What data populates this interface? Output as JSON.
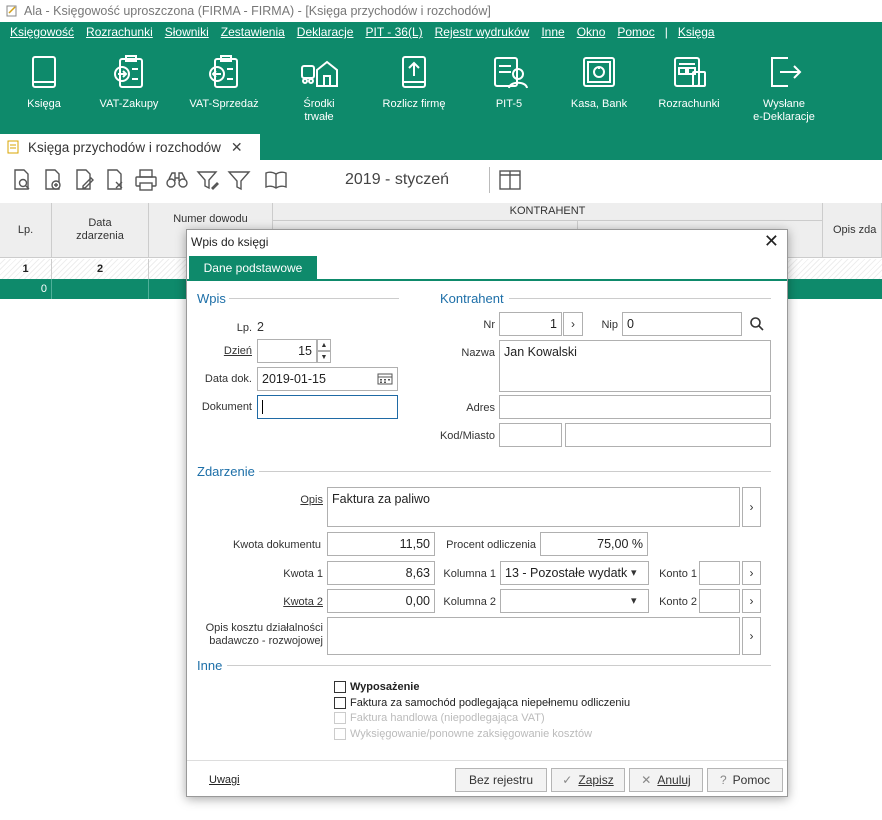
{
  "window": {
    "title": "Ala - Księgowość uproszczona (FIRMA - FIRMA) - [Księga przychodów i rozchodów]"
  },
  "menu": [
    "Księgowość",
    "Rozrachunki",
    "Słowniki",
    "Zestawienia",
    "Deklaracje",
    "PIT - 36(L)",
    "Rejestr wydruków",
    "Inne",
    "Okno",
    "Pomoc",
    "Księga"
  ],
  "ribbon": [
    {
      "label": "Księga",
      "icon": "book-icon"
    },
    {
      "label": "VAT-Zakupy",
      "icon": "clipboard-in-icon"
    },
    {
      "label": "VAT-Sprzedaż",
      "icon": "clipboard-out-icon"
    },
    {
      "label": "Środki\ntrwałe",
      "icon": "fixed-assets-icon"
    },
    {
      "label": "Rozlicz firmę",
      "icon": "settle-icon"
    },
    {
      "label": "PIT-5",
      "icon": "pit-icon"
    },
    {
      "label": "Kasa, Bank",
      "icon": "safe-icon"
    },
    {
      "label": "Rozrachunki",
      "icon": "register-icon"
    },
    {
      "label": "Wysłane\ne-Deklaracje",
      "icon": "export-icon"
    }
  ],
  "document_tab": {
    "label": "Księga przychodów i rozchodów"
  },
  "toolbar": {
    "period": "2019 - styczeń"
  },
  "grid": {
    "headers": {
      "lp": "Lp.",
      "data": "Data\nzdarzenia",
      "numer": "Numer dowodu",
      "kontrahent": "KONTRAHENT",
      "opis": "Opis zda"
    },
    "row1": {
      "lp": "1",
      "data": "2"
    },
    "row2": {
      "lp": "0"
    }
  },
  "dialog": {
    "title": "Wpis do księgi",
    "tab": "Dane podstawowe",
    "wpis": {
      "title": "Wpis",
      "lp_label": "Lp.",
      "lp_value": "2",
      "dzien_label": "Dzień",
      "dzien_value": "15",
      "data_label": "Data dok.",
      "data_value": "2019-01-15",
      "dokument_label": "Dokument",
      "dokument_value": ""
    },
    "kontrahent": {
      "title": "Kontrahent",
      "nr_label": "Nr",
      "nr_value": "1",
      "nip_label": "Nip",
      "nip_value": "0",
      "nazwa_label": "Nazwa",
      "nazwa_value": "Jan Kowalski",
      "adres_label": "Adres",
      "adres_value": "",
      "kod_label": "Kod/Miasto",
      "kod_value": "",
      "miasto_value": ""
    },
    "zdarzenie": {
      "title": "Zdarzenie",
      "opis_label": "Opis",
      "opis_value": "Faktura za paliwo",
      "kwota_dok_label": "Kwota dokumentu",
      "kwota_dok_value": "11,50",
      "procent_label": "Procent odliczenia",
      "procent_value": "75,00 %",
      "kwota1_label": "Kwota 1",
      "kwota1_value": "8,63",
      "kolumna1_label": "Kolumna 1",
      "kolumna1_value": "13 - Pozostałe wydatk",
      "konto1_label": "Konto 1",
      "konto1_value": "",
      "kwota2_label": "Kwota 2",
      "kwota2_value": "0,00",
      "kolumna2_label": "Kolumna 2",
      "kolumna2_value": "",
      "konto2_label": "Konto 2",
      "konto2_value": "",
      "badawczy_label_1": "Opis kosztu działalności",
      "badawczy_label_2": "badawczo - rozwojowej",
      "badawczy_value": ""
    },
    "inne": {
      "title": "Inne",
      "wyposazenie": "Wyposażenie",
      "samochod": "Faktura za samochód podlegająca niepełnemu odliczeniu",
      "handlowa": "Faktura handlowa (niepodlegająca VAT)",
      "wyksiegowanie": "Wyksięgowanie/ponowne zaksięgowanie kosztów"
    },
    "footer": {
      "uwagi": "Uwagi",
      "bez_rejestru": "Bez rejestru",
      "zapisz": "Zapisz",
      "anuluj": "Anuluj",
      "pomoc": "Pomoc"
    }
  }
}
